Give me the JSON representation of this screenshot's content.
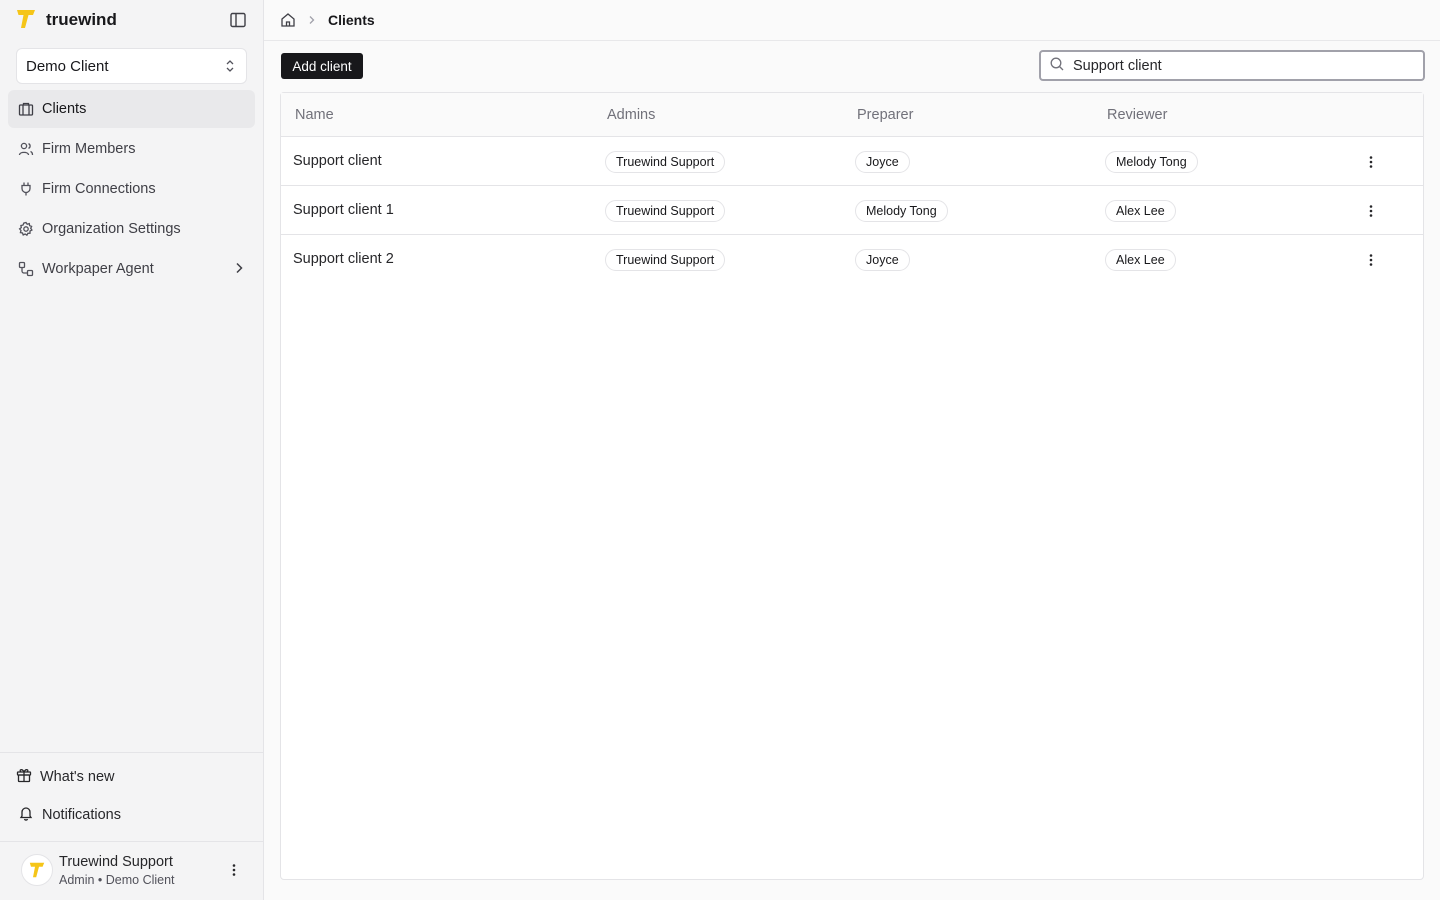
{
  "brand": {
    "name": "truewind"
  },
  "client_selector": {
    "value": "Demo Client"
  },
  "nav": [
    {
      "label": "Clients",
      "icon": "briefcase-icon"
    },
    {
      "label": "Firm Members",
      "icon": "users-icon"
    },
    {
      "label": "Firm Connections",
      "icon": "plug-icon"
    },
    {
      "label": "Organization Settings",
      "icon": "gear-icon"
    },
    {
      "label": "Workpaper Agent",
      "icon": "workflow-icon"
    }
  ],
  "bottom_nav": {
    "whats_new": "What's new",
    "notifications": "Notifications"
  },
  "user": {
    "name": "Truewind Support",
    "role": "Admin • Demo Client"
  },
  "breadcrumb": {
    "current": "Clients"
  },
  "toolbar": {
    "add_label": "Add client"
  },
  "search": {
    "value": "Support client"
  },
  "table": {
    "columns": [
      "Name",
      "Admins",
      "Preparer",
      "Reviewer"
    ],
    "rows": [
      {
        "name": "Support client",
        "admins": "Truewind Support",
        "preparer": "Joyce",
        "reviewer": "Melody Tong"
      },
      {
        "name": "Support client 1",
        "admins": "Truewind Support",
        "preparer": "Melody Tong",
        "reviewer": "Alex Lee"
      },
      {
        "name": "Support client 2",
        "admins": "Truewind Support",
        "preparer": "Joyce",
        "reviewer": "Alex Lee"
      }
    ]
  },
  "colors": {
    "brand_yellow": "#F5C518",
    "primary": "#18181b"
  }
}
